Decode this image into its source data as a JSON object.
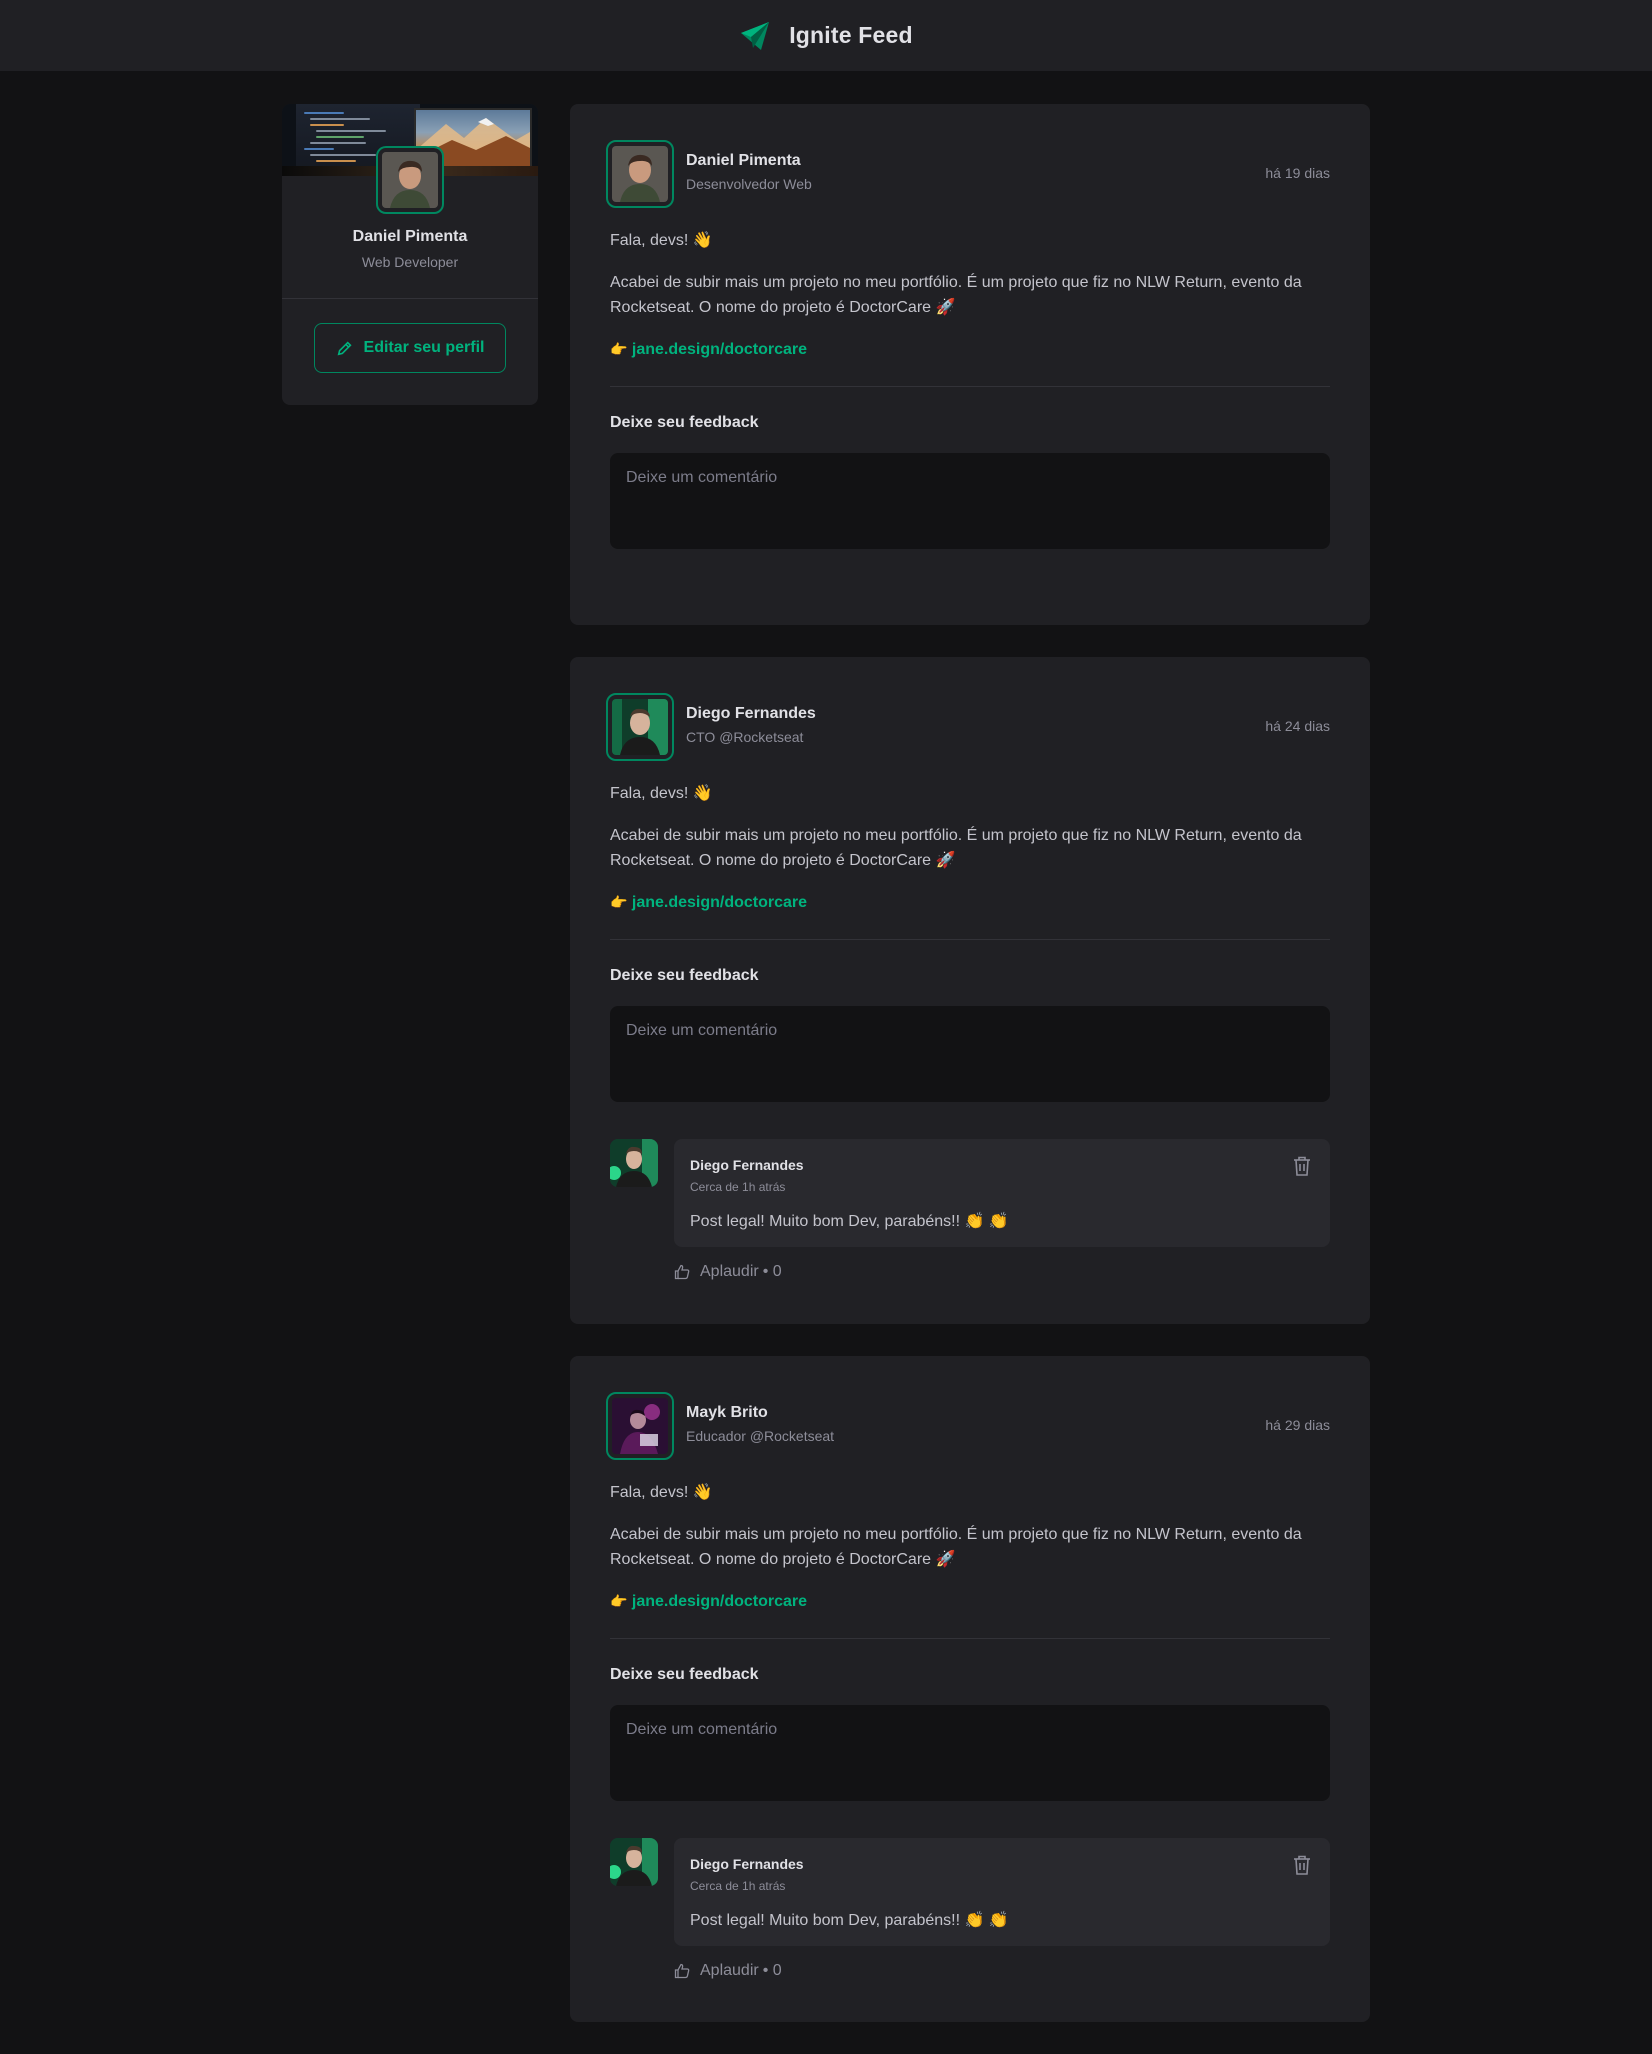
{
  "header": {
    "title": "Ignite Feed",
    "logo_icon": "paper-plane-icon",
    "accent": "#00b37e"
  },
  "sidebar": {
    "name": "Daniel Pimenta",
    "role": "Web Developer",
    "edit_label": "Editar seu perfil",
    "edit_icon": "pencil-icon"
  },
  "posts": [
    {
      "author": "Daniel Pimenta",
      "role": "Desenvolvedor Web",
      "time": "há 19 dias",
      "greeting": "Fala, devs! 👋",
      "body": "Acabei de subir mais um projeto no meu portfólio. É um projeto que fiz no NLW Return, evento da Rocketseat. O nome do projeto é DoctorCare 🚀",
      "link_prefix": "👉",
      "link": "jane.design/doctorcare",
      "feedback_title": "Deixe seu feedback",
      "placeholder": "Deixe um comentário"
    },
    {
      "author": "Diego Fernandes",
      "role": "CTO @Rocketseat",
      "time": "há 24 dias",
      "greeting": "Fala, devs! 👋",
      "body": "Acabei de subir mais um projeto no meu portfólio. É um projeto que fiz no NLW Return, evento da Rocketseat. O nome do projeto é DoctorCare 🚀",
      "link_prefix": "👉",
      "link": "jane.design/doctorcare",
      "feedback_title": "Deixe seu feedback",
      "placeholder": "Deixe um comentário",
      "comment": {
        "author": "Diego Fernandes",
        "time": "Cerca de 1h atrás",
        "text": "Post legal! Muito bom Dev, parabéns!! 👏 👏",
        "applaud_label": "Aplaudir",
        "applaud_count": "• 0"
      }
    },
    {
      "author": "Mayk Brito",
      "role": "Educador @Rocketseat",
      "time": "há 29 dias",
      "greeting": "Fala, devs! 👋",
      "body": "Acabei de subir mais um projeto no meu portfólio. É um projeto que fiz no NLW Return, evento da Rocketseat. O nome do projeto é DoctorCare 🚀",
      "link_prefix": "👉",
      "link": "jane.design/doctorcare",
      "feedback_title": "Deixe seu feedback",
      "placeholder": "Deixe um comentário",
      "comment": {
        "author": "Diego Fernandes",
        "time": "Cerca de 1h atrás",
        "text": "Post legal! Muito bom Dev, parabéns!! 👏 👏",
        "applaud_label": "Aplaudir",
        "applaud_count": "• 0"
      }
    }
  ]
}
